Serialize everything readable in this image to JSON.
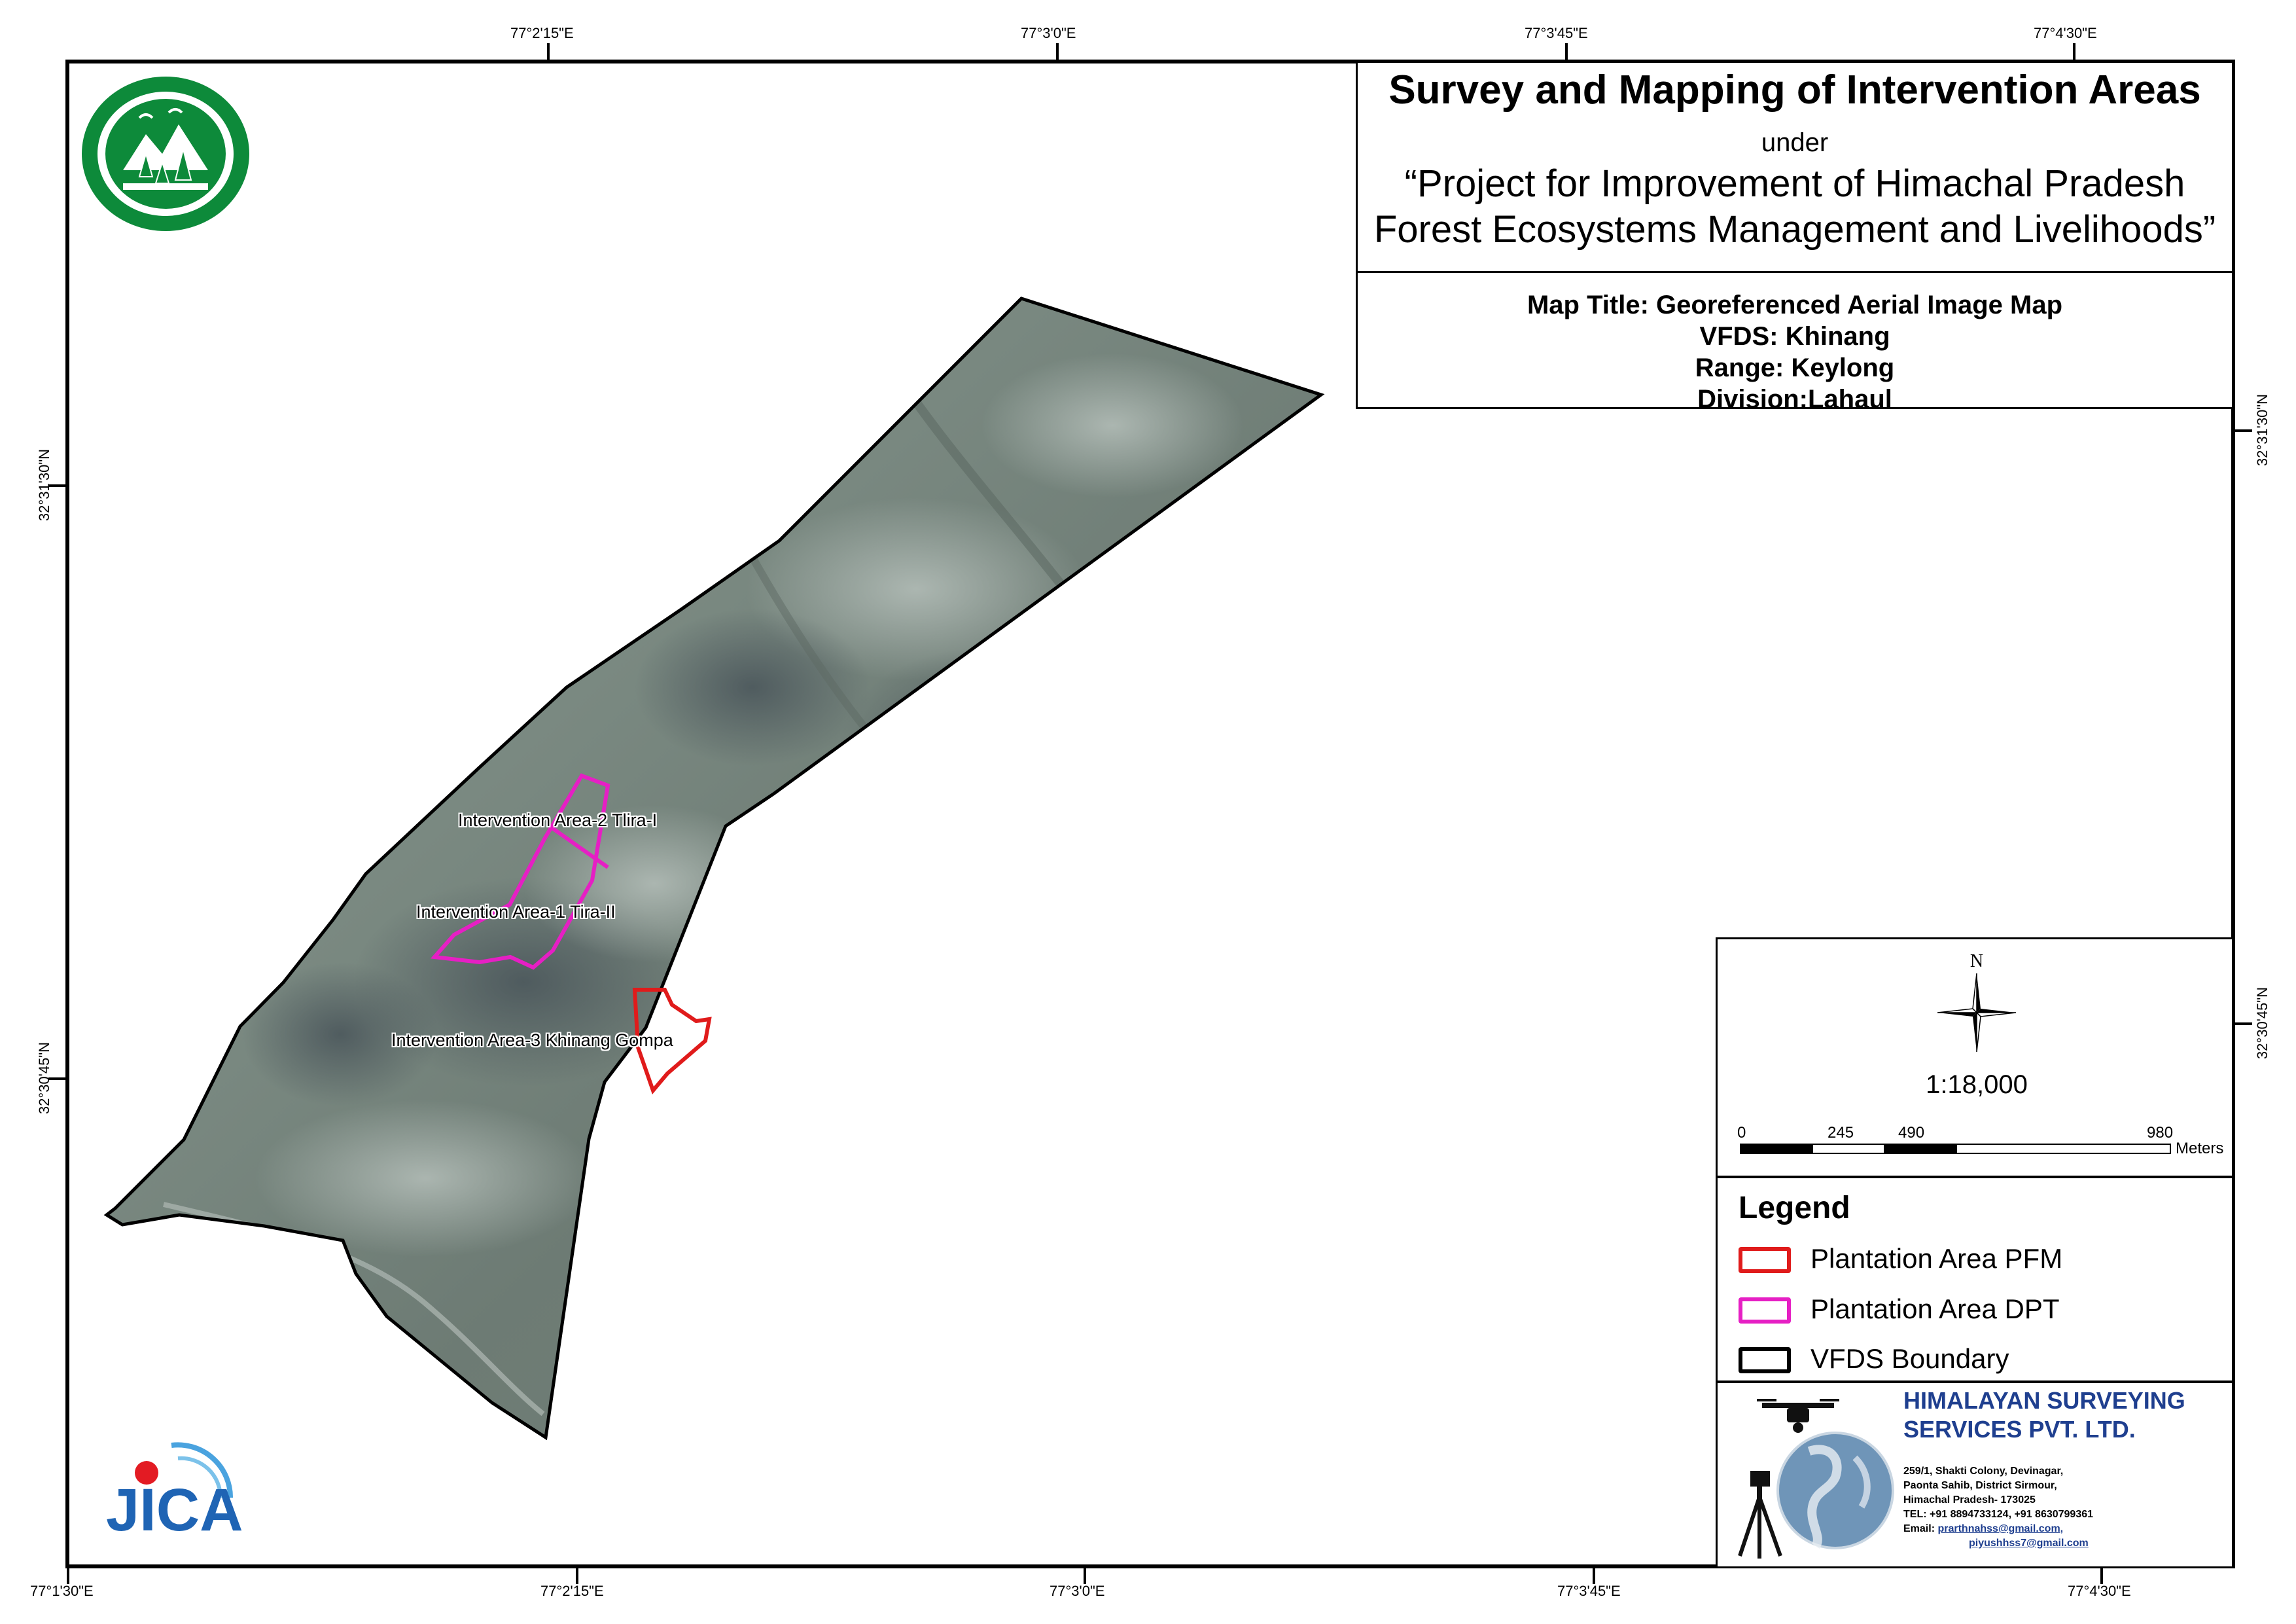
{
  "title": {
    "main": "Survey and Mapping of Intervention Areas",
    "under": "under",
    "project_line1": "“Project for Improvement of Himachal Pradesh",
    "project_line2": "Forest Ecosystems Management and Livelihoods”",
    "map_title": "Map Title: Georeferenced Aerial Image Map",
    "vfds": "VFDS: Khinang",
    "range": "Range: Keylong",
    "division": "Division:Lahaul"
  },
  "coordinates": {
    "top": [
      "77°2'15\"E",
      "77°3'0\"E",
      "77°3'45\"E",
      "77°4'30\"E"
    ],
    "bottom": [
      "77°1'30\"E",
      "77°2'15\"E",
      "77°3'0\"E",
      "77°3'45\"E",
      "77°4'30\"E"
    ],
    "left": [
      "32°31'30\"N",
      "32°30'45\"N"
    ],
    "right": [
      "32°31'30\"N",
      "32°30'45\"N"
    ]
  },
  "map_labels": {
    "area2": "Intervention Area-2 Tlira-I",
    "area1": "Intervention Area-1 Tira-II",
    "area3": "Intervention Area-3 Khinang Gompa"
  },
  "north": {
    "letter": "N",
    "scale": "1:18,000",
    "scale_ticks": [
      "0",
      "245",
      "490",
      "980"
    ],
    "unit": "Meters"
  },
  "legend": {
    "title": "Legend",
    "items": [
      {
        "label": "Plantation Area PFM",
        "color": "#e01b1b"
      },
      {
        "label": "Plantation Area DPT",
        "color": "#e61fc4"
      },
      {
        "label": "VFDS Boundary",
        "color": "#000000"
      }
    ]
  },
  "company": {
    "name_line1": "HIMALAYAN SURVEYING",
    "name_line2": "SERVICES PVT. LTD.",
    "address1": "259/1, Shakti Colony, Devinagar,",
    "address2": "Paonta Sahib, District Sirmour,",
    "address3": "Himachal Pradesh- 173025",
    "tel": "TEL: +91 8894733124, +91 8630799361",
    "email_label": "Email:",
    "email1": "prarthnahss@gmail.com,",
    "email2": "piyushhss7@gmail.com",
    "brand_color": "#1f3f8f"
  },
  "logos": {
    "forest_dept": "Himachal Pradesh Forest Department emblem",
    "jica": "JICA"
  }
}
